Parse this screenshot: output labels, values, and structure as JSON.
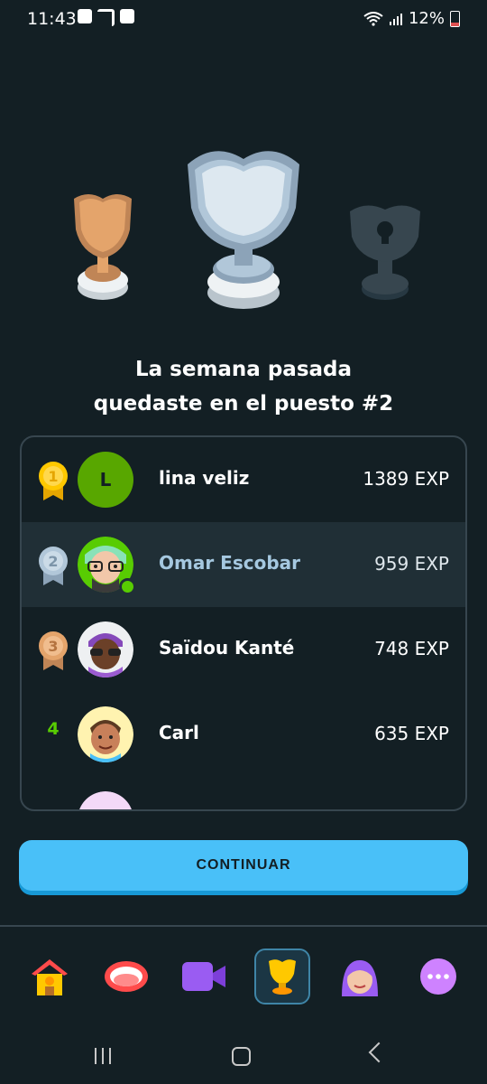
{
  "status_bar": {
    "time": "11:43",
    "battery": "12%"
  },
  "result": {
    "line1": "La semana pasada",
    "line2": "quedaste en el puesto #2"
  },
  "leaderboard": [
    {
      "rank": "1",
      "name": "lina veliz",
      "xp": "1389 EXP",
      "avatar_letter": "L"
    },
    {
      "rank": "2",
      "name": "Omar Escobar",
      "xp": "959 EXP"
    },
    {
      "rank": "3",
      "name": "Saïdou Kanté",
      "xp": "748 EXP"
    },
    {
      "rank": "4",
      "name": "Carl",
      "xp": "635 EXP"
    }
  ],
  "continue_label": "CONTINUAR",
  "colors": {
    "background": "#131f24",
    "accent": "#49c0f8",
    "gold": "#ffc800",
    "silver": "#b1c7d9",
    "bronze": "#e4a46b",
    "green": "#58cc02"
  },
  "tabs": [
    "home-icon",
    "speak-icon",
    "video-icon",
    "leaderboard-icon",
    "profile-icon",
    "more-icon"
  ]
}
